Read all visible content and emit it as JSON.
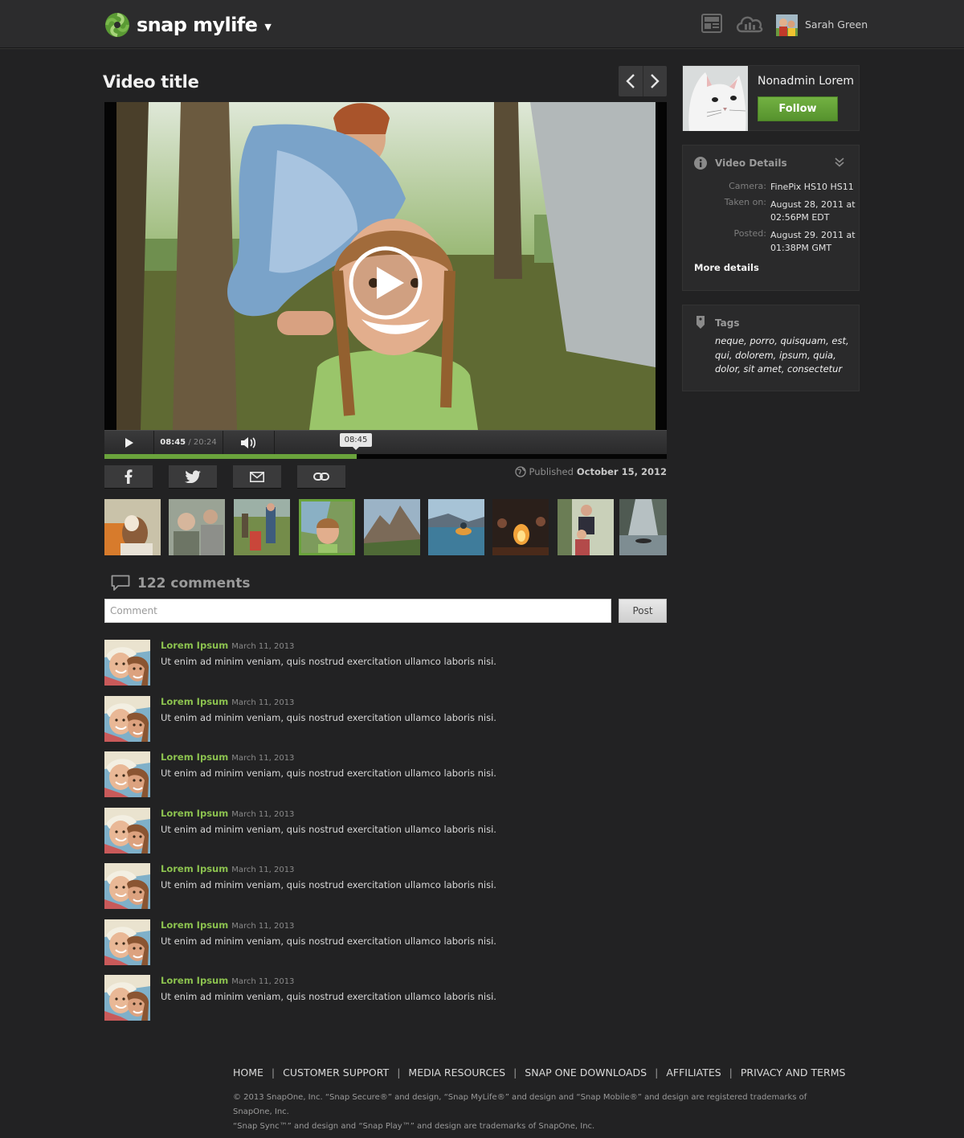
{
  "header": {
    "brand": "snap mylife",
    "user_name": "Sarah Green"
  },
  "main": {
    "title": "Video title",
    "player": {
      "current_time": "08:45",
      "duration": "20:24",
      "time_separator": " / ",
      "tooltip_time": "08:45",
      "progress_fraction": 0.448
    },
    "published_label": "Published",
    "published_date": "October 15, 2012"
  },
  "comments": {
    "count_label": "122 comments",
    "input_placeholder": "Comment",
    "post_label": "Post",
    "items": [
      {
        "author": "Lorem Ipsum",
        "date": "March 11, 2013",
        "text": "Ut enim ad minim veniam, quis nostrud exercitation ullamco laboris nisi."
      },
      {
        "author": "Lorem Ipsum",
        "date": "March 11, 2013",
        "text": "Ut enim ad minim veniam, quis nostrud exercitation ullamco laboris nisi."
      },
      {
        "author": "Lorem Ipsum",
        "date": "March 11, 2013",
        "text": "Ut enim ad minim veniam, quis nostrud exercitation ullamco laboris nisi."
      },
      {
        "author": "Lorem Ipsum",
        "date": "March 11, 2013",
        "text": "Ut enim ad minim veniam, quis nostrud exercitation ullamco laboris nisi."
      },
      {
        "author": "Lorem Ipsum",
        "date": "March 11, 2013",
        "text": "Ut enim ad minim veniam, quis nostrud exercitation ullamco laboris nisi."
      },
      {
        "author": "Lorem Ipsum",
        "date": "March 11, 2013",
        "text": "Ut enim ad minim veniam, quis nostrud exercitation ullamco laboris nisi."
      },
      {
        "author": "Lorem Ipsum",
        "date": "March 11, 2013",
        "text": "Ut enim ad minim veniam, quis nostrud exercitation ullamco laboris nisi."
      }
    ]
  },
  "sidebar": {
    "profile": {
      "name": "Nonadmin Lorem",
      "follow_label": "Follow"
    },
    "details": {
      "title": "Video Details",
      "camera_label": "Camera:",
      "camera_value": "FinePix HS10 HS11",
      "taken_label": "Taken on:",
      "taken_value": "August 28, 2011 at 02:56PM EDT",
      "posted_label": "Posted:",
      "posted_value": "August 29. 2011 at 01:38PM GMT",
      "more_label": "More details"
    },
    "tags": {
      "title": "Tags",
      "text": "neque, porro, quisquam, est, qui, dolorem, ipsum, quia, dolor, sit amet, consectetur"
    }
  },
  "footer": {
    "links": [
      "HOME",
      "CUSTOMER SUPPORT",
      "MEDIA RESOURCES",
      "SNAP ONE DOWNLOADS",
      "AFFILIATES",
      "PRIVACY AND TERMS"
    ],
    "copyright_line1": "© 2013 SnapOne, Inc. “Snap Secure®” and design, “Snap MyLife®” and design and “Snap Mobile®” and design are registered trademarks of SnapOne, Inc.",
    "copyright_line2": "“Snap Sync™” and design and “Snap Play™” and design are trademarks of SnapOne, Inc."
  },
  "colors": {
    "accent_green": "#6aa33c",
    "author_green": "#8cc24f",
    "background": "#222223"
  },
  "icons": [
    "snap-logo-icon",
    "chevron-down-icon",
    "news-icon",
    "cloud-icon",
    "chevron-left-icon",
    "chevron-right-icon",
    "play-icon",
    "volume-icon",
    "facebook-icon",
    "twitter-icon",
    "email-icon",
    "link-icon",
    "globe-icon",
    "comment-bubble-icon",
    "info-icon",
    "double-chevron-down-icon",
    "tag-icon"
  ]
}
